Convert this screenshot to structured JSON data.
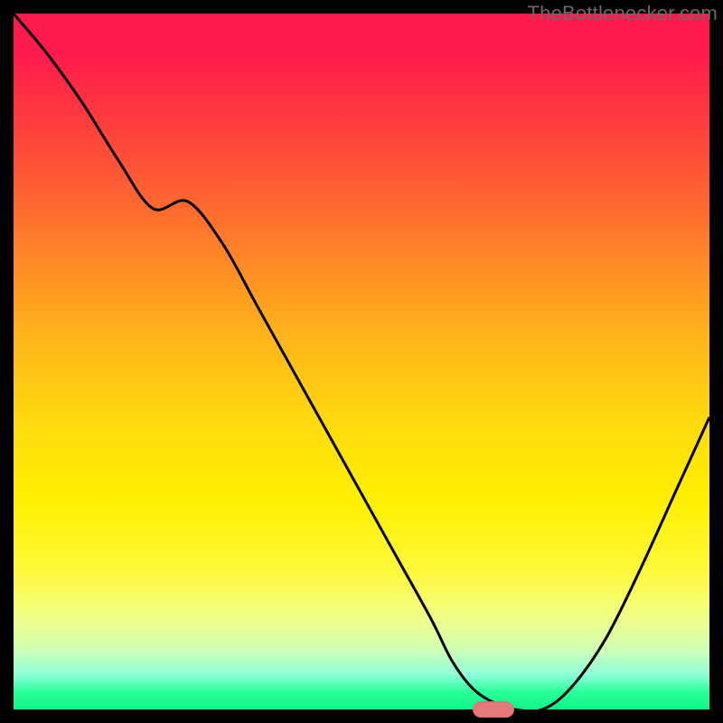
{
  "watermark": {
    "text": "TheBottlenecker.com"
  },
  "chart_data": {
    "type": "line",
    "title": "",
    "xlabel": "",
    "ylabel": "",
    "xlim": [
      0,
      100
    ],
    "ylim": [
      0,
      100
    ],
    "x": [
      0,
      5,
      10,
      15,
      20,
      25,
      30,
      35,
      40,
      45,
      50,
      55,
      60,
      63,
      66,
      69,
      72,
      76,
      80,
      85,
      90,
      95,
      100
    ],
    "values": [
      100,
      94,
      87,
      79,
      72,
      73,
      67,
      58,
      49,
      40,
      31,
      22,
      13,
      7,
      3,
      1,
      0,
      0,
      3,
      10,
      20,
      31,
      42
    ],
    "optimum_range": {
      "x_start": 66,
      "x_end": 72,
      "y": 0
    }
  },
  "colors": {
    "curve": "#000000",
    "marker": "#e37a78",
    "frame": "#000000"
  }
}
